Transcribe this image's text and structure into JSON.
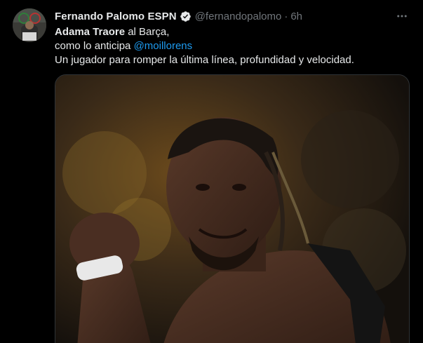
{
  "tweet": {
    "author_name": "Fernando Palomo ESPN",
    "handle": "@fernandopalomo",
    "separator": "·",
    "time": "6h",
    "body": {
      "line1_bold": "Adama Traore",
      "line1_rest": " al Barça,",
      "line2_prefix": "como lo anticipa ",
      "line2_mention": "@moillorens",
      "line3": "Un jugador para romper la última línea, profundidad y velocidad."
    }
  },
  "icons": {
    "verified": "verified-badge-icon",
    "more": "more-options-icon"
  },
  "colors": {
    "background": "#000000",
    "text_primary": "#e7e9ea",
    "text_secondary": "#71767b",
    "accent": "#1d9bf0"
  }
}
